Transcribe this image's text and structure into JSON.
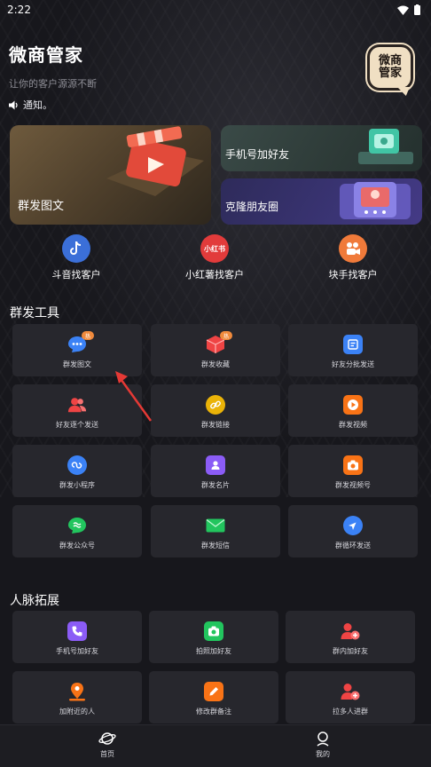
{
  "status": {
    "time": "2:22"
  },
  "header": {
    "title": "微商管家",
    "subtitle": "让你的客户源源不断",
    "notice": "通知。",
    "logo_line1": "微商",
    "logo_line2": "管家"
  },
  "banners": {
    "left": "群发图文",
    "top_right": "手机号加好友",
    "bottom_right": "克隆朋友圈"
  },
  "quick": [
    {
      "label": "斗音找客户",
      "icon": "tiktok-icon",
      "color": "#3b6fd8"
    },
    {
      "label": "小红薯找客户",
      "icon_text": "小红书",
      "icon": "xiaohongshu-icon",
      "color": "#e23b3b"
    },
    {
      "label": "块手找客户",
      "icon": "kuaishou-icon",
      "color": "#f07a3a"
    }
  ],
  "group_tools": {
    "title": "群发工具",
    "badge": "热",
    "items": [
      {
        "label": "群发图文",
        "icon": "chat-bubble-icon",
        "color": "#3b82f6"
      },
      {
        "label": "群发收藏",
        "icon": "cube-icon",
        "color": "#ef4444"
      },
      {
        "label": "好友分批发送",
        "icon": "list-doc-icon",
        "color": "#3b82f6"
      },
      {
        "label": "好友逐个发送",
        "icon": "users-icon",
        "color": "#ef4444"
      },
      {
        "label": "群发链接",
        "icon": "link-icon",
        "color": "#eab308"
      },
      {
        "label": "群发视频",
        "icon": "play-icon",
        "color": "#f97316"
      },
      {
        "label": "群发小程序",
        "icon": "miniapp-icon",
        "color": "#3b82f6"
      },
      {
        "label": "群发名片",
        "icon": "contact-card-icon",
        "color": "#8b5cf6"
      },
      {
        "label": "群发视频号",
        "icon": "camera-icon",
        "color": "#f97316"
      },
      {
        "label": "群发公众号",
        "icon": "official-account-icon",
        "color": "#22c55e"
      },
      {
        "label": "群发短信",
        "icon": "mail-icon",
        "color": "#22c55e"
      },
      {
        "label": "群循环发送",
        "icon": "compass-icon",
        "color": "#3b82f6"
      }
    ]
  },
  "network": {
    "title": "人脉拓展",
    "items": [
      {
        "label": "手机号加好友",
        "icon": "phone-icon",
        "color": "#8b5cf6"
      },
      {
        "label": "拍照加好友",
        "icon": "camera-icon",
        "color": "#22c55e"
      },
      {
        "label": "群内加好友",
        "icon": "add-user-icon",
        "color": "#ef4444"
      },
      {
        "label": "加附近的人",
        "icon": "location-pin-icon",
        "color": "#f97316"
      },
      {
        "label": "修改群备注",
        "icon": "edit-icon",
        "color": "#f97316"
      },
      {
        "label": "拉多人进群",
        "icon": "add-user-icon",
        "color": "#ef4444"
      }
    ]
  },
  "nav": {
    "home": "首页",
    "mine": "我的"
  }
}
